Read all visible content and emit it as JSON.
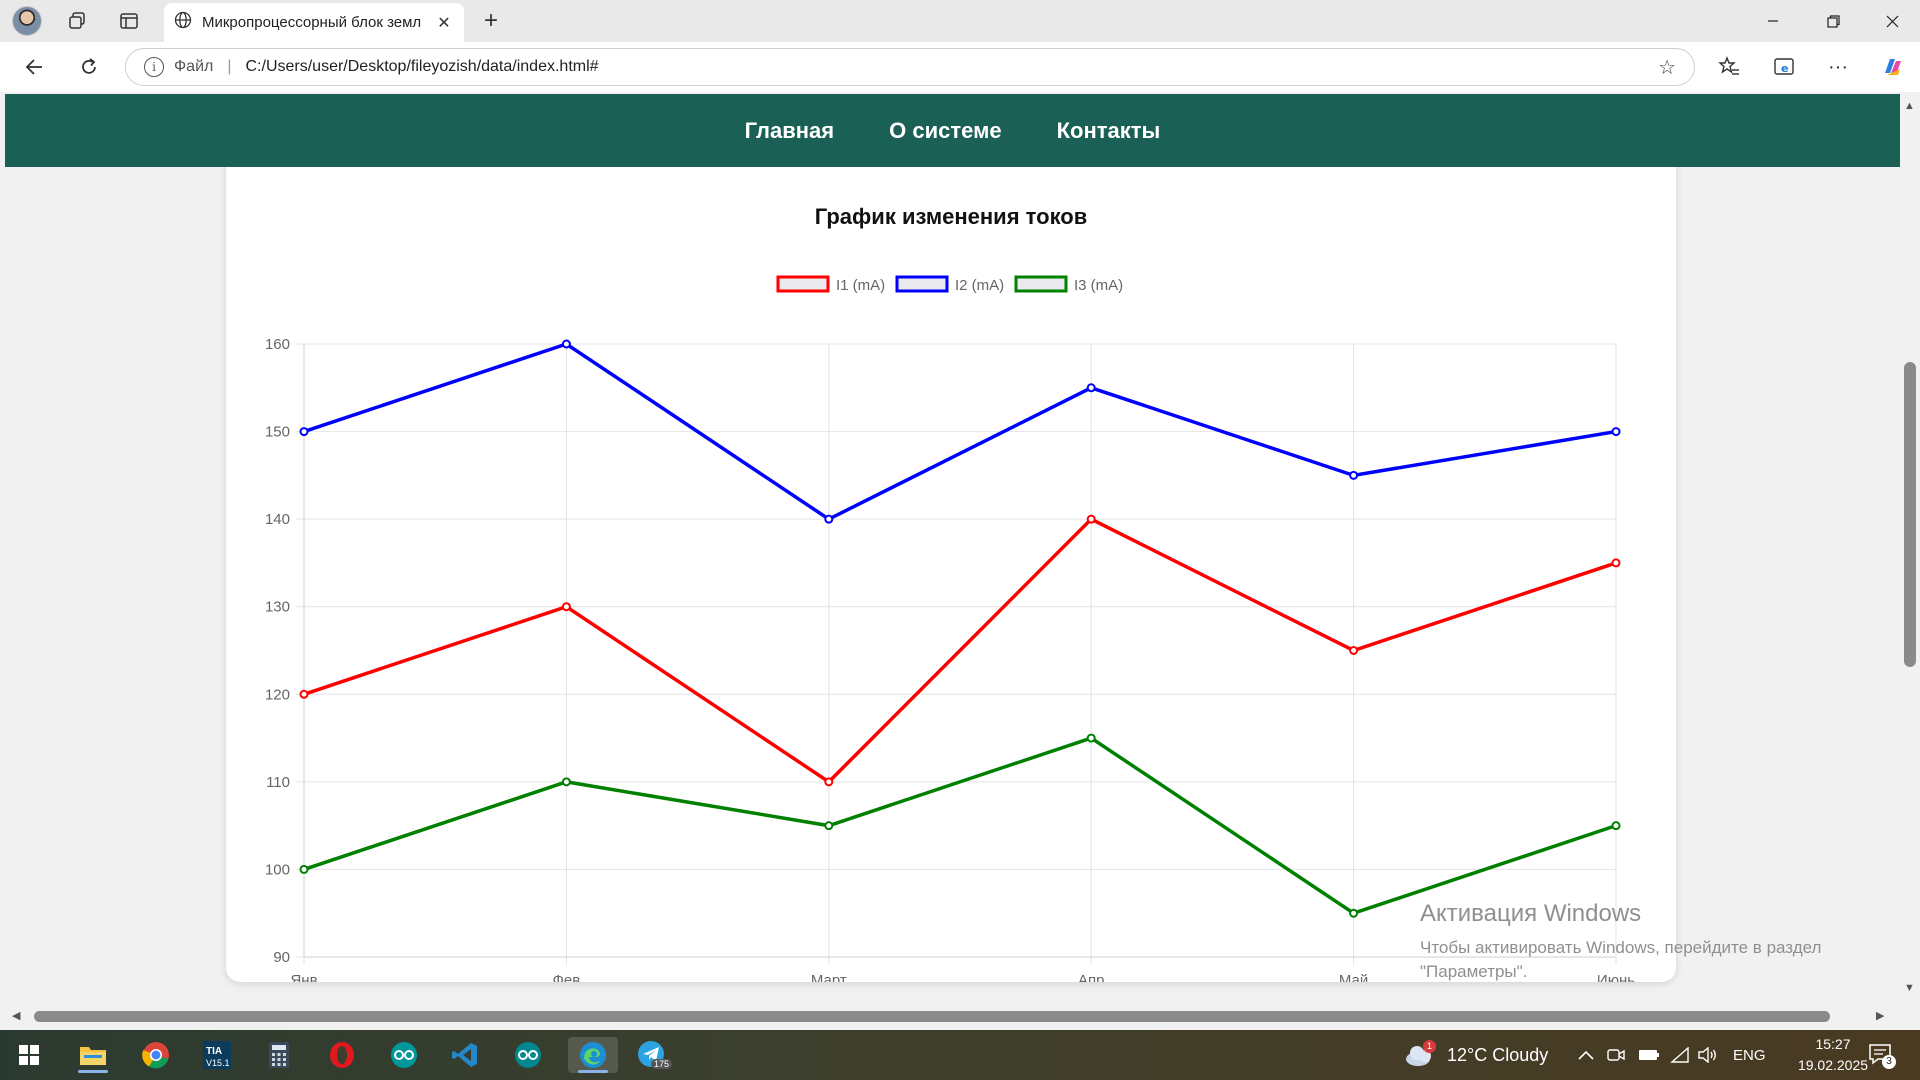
{
  "browser": {
    "tab_title": "Микропроцессорный блок земл",
    "address_scheme": "Файл",
    "address_url": "C:/Users/user/Desktop/fileyozish/data/index.html#"
  },
  "nav": {
    "items": [
      "Главная",
      "О системе",
      "Контакты"
    ]
  },
  "chart_data": {
    "type": "line",
    "title": "График изменения токов",
    "categories": [
      "Янв",
      "Фев",
      "Март",
      "Апр",
      "Май",
      "Июнь"
    ],
    "ylim": [
      90,
      160
    ],
    "yticks": [
      "160",
      "150",
      "140",
      "130",
      "120",
      "110",
      "100",
      "90"
    ],
    "grid": true,
    "legend_position": "top",
    "series": [
      {
        "name": "I1 (mA)",
        "color": "#ff0000",
        "values": [
          120,
          130,
          110,
          140,
          125,
          135
        ]
      },
      {
        "name": "I2 (mA)",
        "color": "#0000ff",
        "values": [
          150,
          160,
          140,
          155,
          145,
          150
        ]
      },
      {
        "name": "I3 (mA)",
        "color": "#008000",
        "values": [
          100,
          110,
          105,
          115,
          95,
          105
        ]
      }
    ]
  },
  "watermark": {
    "title": "Активация Windows",
    "subtitle": "Чтобы активировать Windows, перейдите в раздел \"Параметры\"."
  },
  "taskbar": {
    "weather": "12°C  Cloudy",
    "badge_weather": "1",
    "badge_telegram": "175",
    "language": "ENG",
    "time": "15:27",
    "date": "19.02.2025",
    "notifications": "3"
  }
}
